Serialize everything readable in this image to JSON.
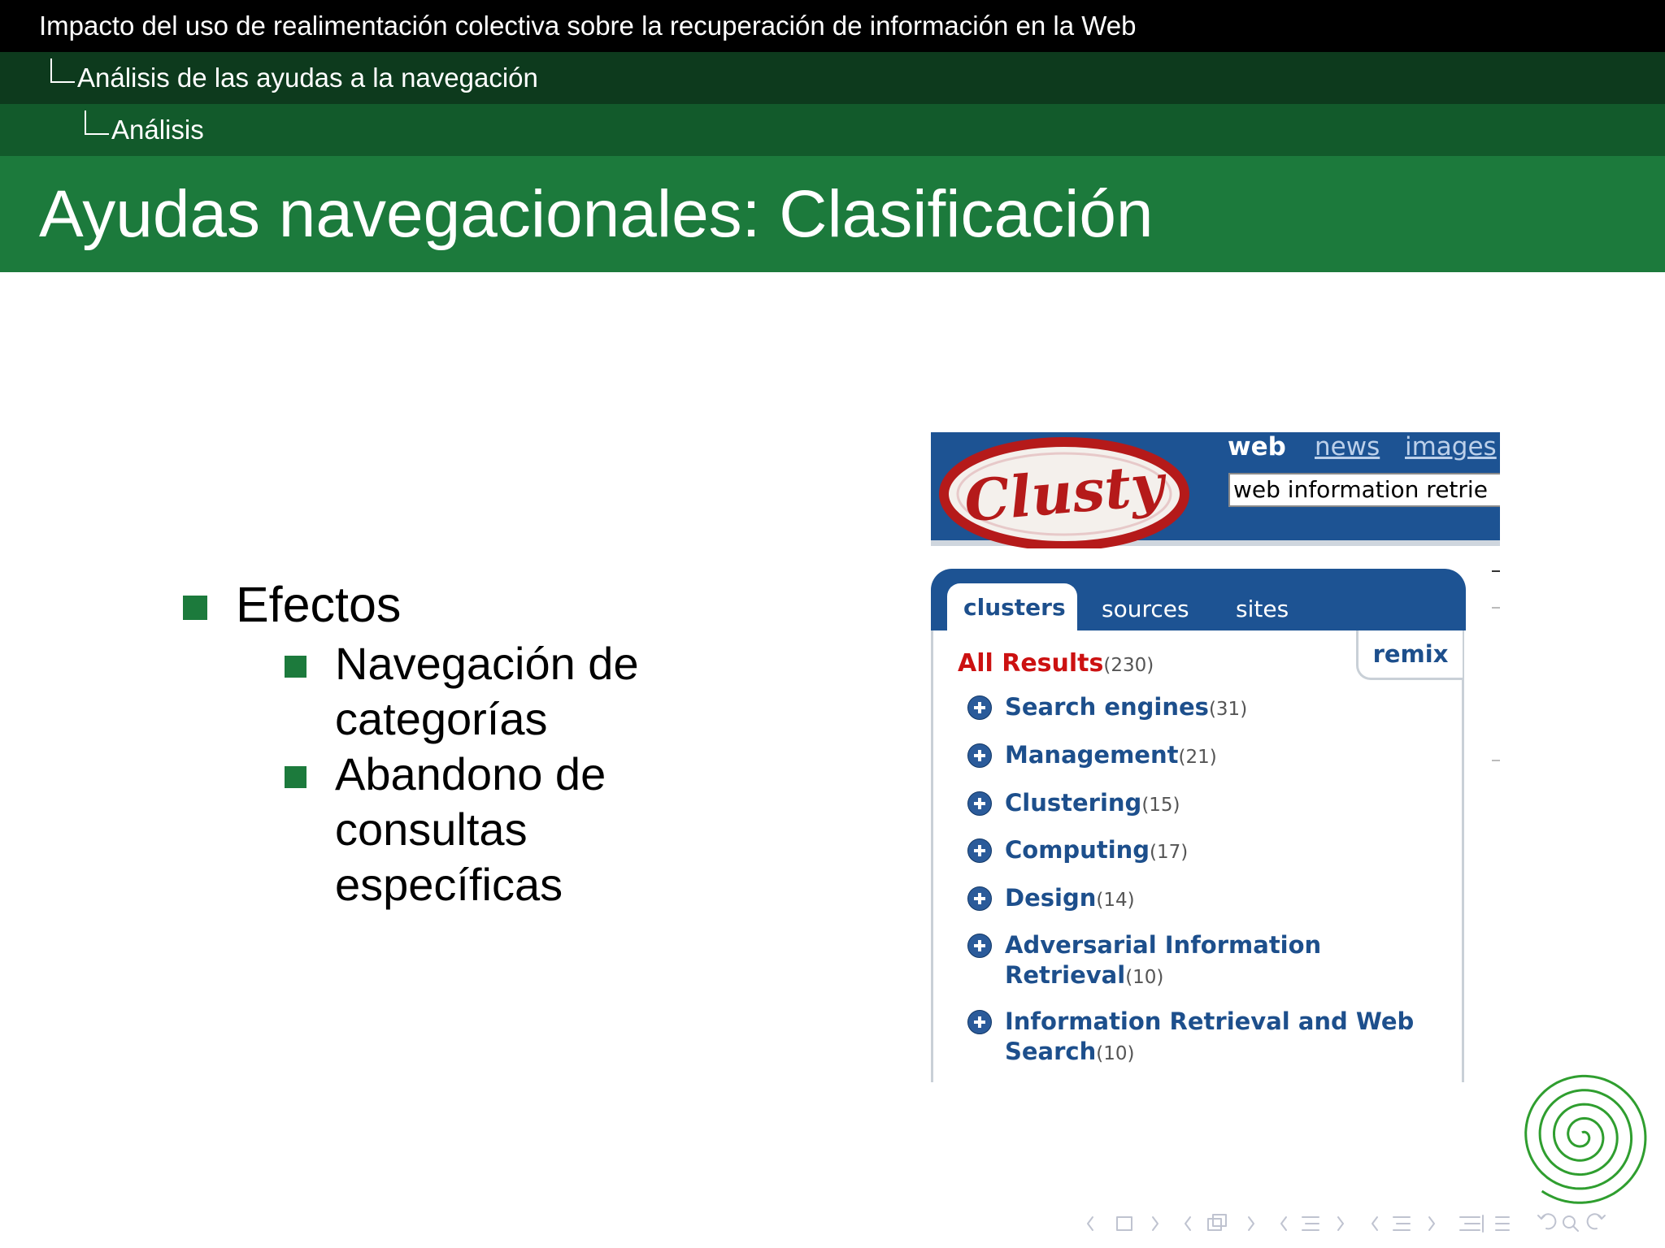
{
  "header": {
    "presentation_title": "Impacto del uso de realimentación colectiva sobre la recuperación de información en la Web",
    "section": "Análisis de las ayudas a la navegación",
    "subsection": "Análisis",
    "slide_title": "Ayudas navegacionales: Clasificación"
  },
  "content": {
    "bullet": "Efectos",
    "subbullets": [
      "Navegación de categorías",
      "Abandono de consultas específicas"
    ]
  },
  "clusty": {
    "logo_text": "Clusty",
    "nav": {
      "web": "web",
      "news": "news",
      "images": "images"
    },
    "search_value": "web information retrie",
    "tabs": {
      "clusters": "clusters",
      "sources": "sources",
      "sites": "sites"
    },
    "remix": "remix",
    "all_results": {
      "label": "All Results",
      "count": "(230)"
    },
    "clusters": [
      {
        "name": "Search engines",
        "count": "(31)"
      },
      {
        "name": "Management",
        "count": "(21)"
      },
      {
        "name": "Clustering",
        "count": "(15)"
      },
      {
        "name": "Computing",
        "count": "(17)"
      },
      {
        "name": "Design",
        "count": "(14)"
      },
      {
        "name": "Adversarial Information Retrieval",
        "count": "(10)"
      },
      {
        "name": "Information Retrieval and Web Search",
        "count": "(10)"
      }
    ]
  },
  "colors": {
    "structure_green": "#1c7a3c",
    "clusty_blue": "#1d5393",
    "clusty_red": "#cc1111"
  }
}
